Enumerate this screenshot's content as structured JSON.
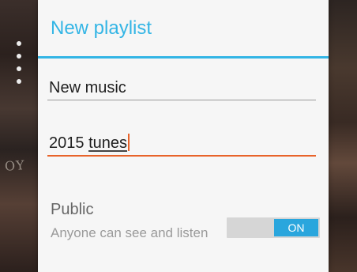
{
  "dialog": {
    "title": "New playlist",
    "name_field": {
      "value": "New music"
    },
    "description_field": {
      "word_1": "2015",
      "word_2": "tunes"
    },
    "public_setting": {
      "label": "Public",
      "description": "Anyone can see and listen",
      "toggle_text": "ON",
      "enabled": true
    }
  },
  "background": {
    "partial_text": "OY"
  },
  "colors": {
    "accent": "#33b5e5",
    "focus_underline": "#e8632a",
    "toggle_on": "#2aa6dd"
  }
}
